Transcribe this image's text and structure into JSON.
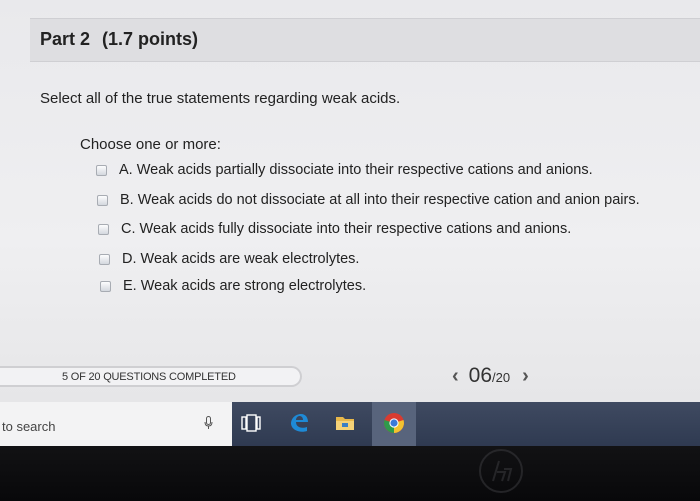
{
  "question": {
    "part_label": "Part 2",
    "points": "(1.7 points)",
    "prompt": "Select all of the true statements regarding weak acids.",
    "choose_label": "Choose one or more:",
    "options": [
      {
        "text": "A. Weak acids partially dissociate into their respective cations and anions."
      },
      {
        "text": "B. Weak acids do not dissociate at all into their respective cation and anion pairs."
      },
      {
        "text": "C. Weak acids fully dissociate into their respective cations and anions."
      },
      {
        "text": "D. Weak acids are weak electrolytes."
      },
      {
        "text": "E. Weak acids are strong electrolytes."
      }
    ]
  },
  "footer": {
    "progress_text": "5 OF 20 QUESTIONS COMPLETED",
    "prev_symbol": "‹",
    "current_page": "06",
    "total_pages": "/20",
    "next_symbol": "›"
  },
  "taskbar": {
    "search_text": "to search",
    "icons": [
      "microphone-icon",
      "task-view-icon",
      "edge-icon",
      "file-explorer-icon",
      "chrome-icon"
    ]
  },
  "colors": {
    "screen_bg": "#ececef",
    "header_bg": "#dedee1",
    "taskbar_bg": "#36415a",
    "edge_blue": "#1e8ad6"
  }
}
